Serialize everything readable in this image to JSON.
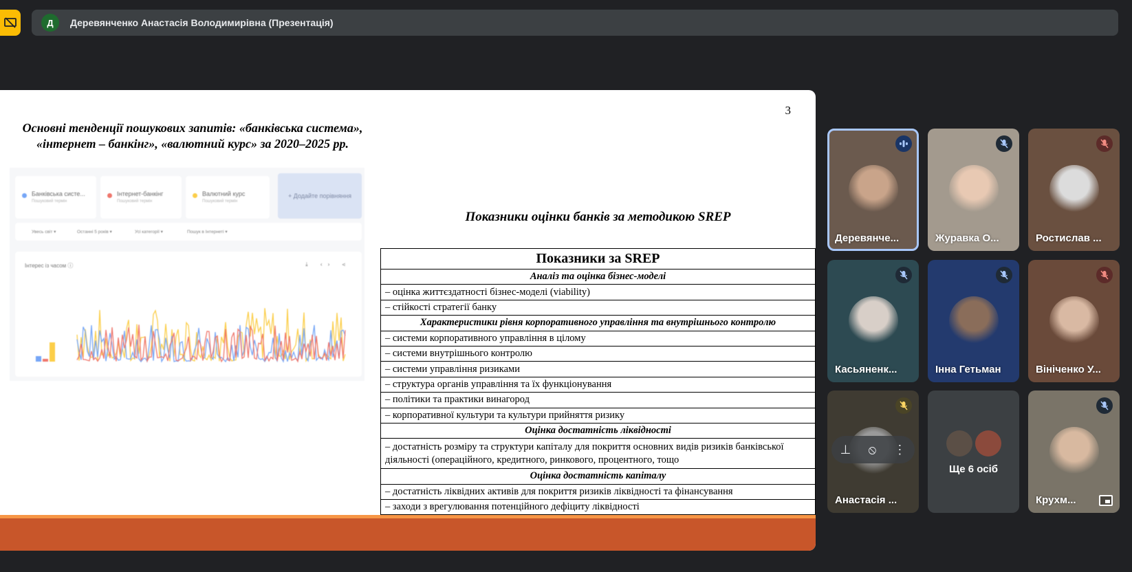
{
  "topbar": {
    "presenter_initial": "Д",
    "title": "Деревянченко Анастасія Володимирівна (Презентація)"
  },
  "slide": {
    "number": "3",
    "title_line1": "Основні тенденції пошукових запитів: «банківська система»,",
    "title_line2": "«інтернет – банкінг», «валютний курс» за 2020–2025 рр.",
    "srep_heading": "Показники оцінки банків за методикою SREP",
    "trends": {
      "terms": [
        {
          "label": "Банківська систе...",
          "sub": "Пошуковий термін",
          "color": "#4285f4"
        },
        {
          "label": "Інтернет-банкінг",
          "sub": "Пошуковий термін",
          "color": "#ea4335"
        },
        {
          "label": "Валютний курс",
          "sub": "Пошуковий термін",
          "color": "#fbbc04"
        }
      ],
      "add_compare": "+ Додайте порівняння",
      "filters": [
        "Увесь світ ▾",
        "Останні 5 років ▾",
        "Усі категорії ▾",
        "Пошук в Інтернеті ▾"
      ],
      "chart_label": "Інтерес із часом ⓘ",
      "chart_tools": "⤓ ‹› ⋖"
    },
    "table": {
      "header": "Показники за SREP",
      "rows": [
        {
          "type": "section",
          "text": "Аналіз та оцінка бізнес-моделі"
        },
        {
          "type": "item",
          "text": "– оцінка життєздатності бізнес-моделі (viability)"
        },
        {
          "type": "item",
          "text": "– стійкості стратегії банку"
        },
        {
          "type": "section",
          "text": "Характеристики рівня корпоративного управління та внутрішнього контролю"
        },
        {
          "type": "item",
          "text": "– системи корпоративного управління в цілому"
        },
        {
          "type": "item",
          "text": "– системи внутрішнього контролю"
        },
        {
          "type": "item",
          "text": "– системи управління ризиками"
        },
        {
          "type": "item",
          "text": "– структура органів управління та їх функціонування"
        },
        {
          "type": "item",
          "text": "– політики та практики винагород"
        },
        {
          "type": "item",
          "text": "– корпоративної культури та культури прийняття ризику"
        },
        {
          "type": "section",
          "text": "Оцінка достатність ліквідності"
        },
        {
          "type": "item-tall",
          "text": "– достатність розміру та структури капіталу для покриття основних видів ризиків банківської діяльності (операційного, кредитного, ринкового, процентного, тощо"
        },
        {
          "type": "section",
          "text": "Оцінка достатність капіталу"
        },
        {
          "type": "item",
          "text": "– достатність ліквідних активів для покриття ризиків ліквідності та фінансування"
        },
        {
          "type": "item",
          "text": "– заходи з врегулювання потенційного дефіциту ліквідності"
        }
      ]
    }
  },
  "participants": [
    {
      "name": "Деревянче...",
      "mic": "speaking",
      "bg": "#6b5a4e",
      "face": "#c9a48a"
    },
    {
      "name": "Журавка О...",
      "mic": "muted-dark",
      "bg": "#a39a8e",
      "face": "#e8c9b3"
    },
    {
      "name": "Ростислав ...",
      "mic": "muted-red",
      "bg": "#6a5040",
      "face": "#dcdcdc"
    },
    {
      "name": "Касьяненк...",
      "mic": "muted-dark",
      "bg": "#2d4a52",
      "face": "#d8cfc8"
    },
    {
      "name": "Інна Гетьман",
      "mic": "muted-dark",
      "bg": "#233a6e",
      "face": "#8a6d5a"
    },
    {
      "name": "Вініченко У...",
      "mic": "muted-red",
      "bg": "#6a4a3a",
      "face": "#d9b9a3"
    },
    {
      "name": "Анастасія ...",
      "mic": "muted-yellow",
      "bg": "#3f3b32",
      "face": "#9a9a9a"
    },
    {
      "name": "Ще 6 осіб",
      "mic": "none",
      "bg": "#3c4043"
    },
    {
      "name": "Крухм...",
      "mic": "muted-dark",
      "bg": "#7a7468",
      "face": "#d8b9a0"
    }
  ],
  "tile_controls": {
    "pin_icon": "pin-icon",
    "mute_icon": "mic-off-icon",
    "more_icon": "more-vert-icon"
  },
  "colors": {
    "background": "#202124",
    "slide_band": "#c8562a",
    "slide_band_top": "#f79646",
    "speaking_outline": "#a8c7fa",
    "stop_share": "#fbbc04"
  }
}
